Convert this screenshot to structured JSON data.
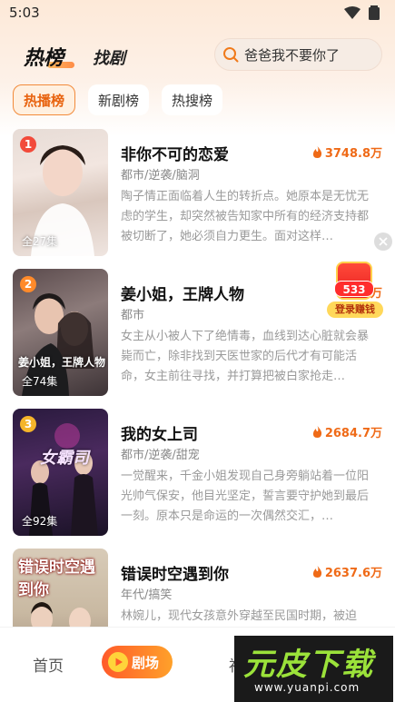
{
  "status_bar": {
    "time": "5:03"
  },
  "header": {
    "tab_hot": "热榜",
    "tab_find": "找剧",
    "search_text": "爸爸我不要你了"
  },
  "chips": [
    {
      "label": "热播榜",
      "active": true
    },
    {
      "label": "新剧榜",
      "active": false
    },
    {
      "label": "热搜榜",
      "active": false
    }
  ],
  "items": [
    {
      "rank": "1",
      "title": "非你不可的恋爱",
      "heat": "3748.8万",
      "genre": "都市/逆袭/脑洞",
      "desc": "陶子情正面临着人生的转折点。她原本是无忧无虑的学生，却突然被告知家中所有的经济支持都被切断了，她必须自力更生。面对这样…",
      "episodes": "全27集",
      "poster_caption": ""
    },
    {
      "rank": "2",
      "title": "姜小姐，王牌人物",
      "heat": "2…万",
      "genre": "都市",
      "desc": "女主从小被人下了绝情毒，血线到达心脏就会暴毙而亡，除非找到天医世家的后代才有可能活命，女主前往寻找，并打算把被白家抢走…",
      "episodes": "全74集",
      "poster_caption": "姜小姐，王牌人物"
    },
    {
      "rank": "3",
      "title": "我的女上司",
      "heat": "2684.7万",
      "genre": "都市/逆袭/甜宠",
      "desc": "一觉醒来，千金小姐发现自己身旁躺站着一位阳光帅气保安，他目光坚定，誓言要守护她到最后一刻。原本只是命运的一次偶然交汇，…",
      "episodes": "全92集",
      "poster_caption": "女霸司"
    },
    {
      "rank": "",
      "title": "错误时空遇到你",
      "heat": "2637.6万",
      "genre": "年代/搞笑",
      "desc": "林婉儿，现代女孩意外穿越至民国时期，被迫",
      "episodes": "",
      "poster_caption": "错误时空遇到你"
    }
  ],
  "red_packet": {
    "count": "533",
    "label": "登录赚钱"
  },
  "bottom_nav": {
    "home": "首页",
    "theater": "剧场",
    "third": "福"
  },
  "watermark": {
    "title": "元皮下载",
    "url": "www.yuanpi.com"
  },
  "colors": {
    "accent": "#ef6a17",
    "rank_1": "#f24a3a",
    "rank_2": "#ff8a2a",
    "rank_3": "#f5b52a"
  }
}
